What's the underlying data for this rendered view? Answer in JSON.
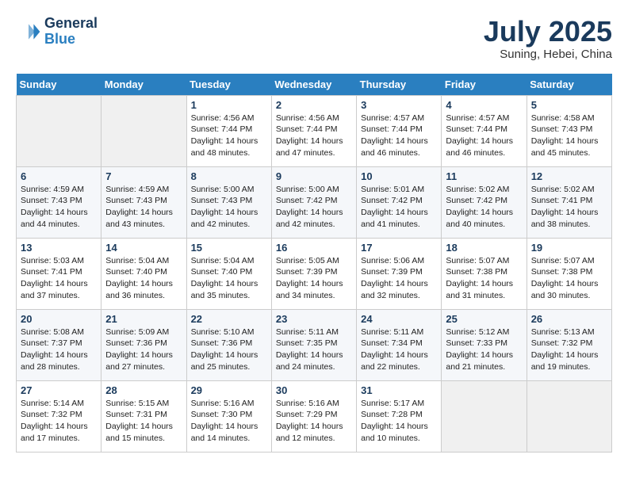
{
  "header": {
    "logo_line1": "General",
    "logo_line2": "Blue",
    "month": "July 2025",
    "location": "Suning, Hebei, China"
  },
  "days_of_week": [
    "Sunday",
    "Monday",
    "Tuesday",
    "Wednesday",
    "Thursday",
    "Friday",
    "Saturday"
  ],
  "weeks": [
    [
      {
        "day": "",
        "empty": true
      },
      {
        "day": "",
        "empty": true
      },
      {
        "day": "1",
        "sunrise": "Sunrise: 4:56 AM",
        "sunset": "Sunset: 7:44 PM",
        "daylight": "Daylight: 14 hours and 48 minutes."
      },
      {
        "day": "2",
        "sunrise": "Sunrise: 4:56 AM",
        "sunset": "Sunset: 7:44 PM",
        "daylight": "Daylight: 14 hours and 47 minutes."
      },
      {
        "day": "3",
        "sunrise": "Sunrise: 4:57 AM",
        "sunset": "Sunset: 7:44 PM",
        "daylight": "Daylight: 14 hours and 46 minutes."
      },
      {
        "day": "4",
        "sunrise": "Sunrise: 4:57 AM",
        "sunset": "Sunset: 7:44 PM",
        "daylight": "Daylight: 14 hours and 46 minutes."
      },
      {
        "day": "5",
        "sunrise": "Sunrise: 4:58 AM",
        "sunset": "Sunset: 7:43 PM",
        "daylight": "Daylight: 14 hours and 45 minutes."
      }
    ],
    [
      {
        "day": "6",
        "sunrise": "Sunrise: 4:59 AM",
        "sunset": "Sunset: 7:43 PM",
        "daylight": "Daylight: 14 hours and 44 minutes."
      },
      {
        "day": "7",
        "sunrise": "Sunrise: 4:59 AM",
        "sunset": "Sunset: 7:43 PM",
        "daylight": "Daylight: 14 hours and 43 minutes."
      },
      {
        "day": "8",
        "sunrise": "Sunrise: 5:00 AM",
        "sunset": "Sunset: 7:43 PM",
        "daylight": "Daylight: 14 hours and 42 minutes."
      },
      {
        "day": "9",
        "sunrise": "Sunrise: 5:00 AM",
        "sunset": "Sunset: 7:42 PM",
        "daylight": "Daylight: 14 hours and 42 minutes."
      },
      {
        "day": "10",
        "sunrise": "Sunrise: 5:01 AM",
        "sunset": "Sunset: 7:42 PM",
        "daylight": "Daylight: 14 hours and 41 minutes."
      },
      {
        "day": "11",
        "sunrise": "Sunrise: 5:02 AM",
        "sunset": "Sunset: 7:42 PM",
        "daylight": "Daylight: 14 hours and 40 minutes."
      },
      {
        "day": "12",
        "sunrise": "Sunrise: 5:02 AM",
        "sunset": "Sunset: 7:41 PM",
        "daylight": "Daylight: 14 hours and 38 minutes."
      }
    ],
    [
      {
        "day": "13",
        "sunrise": "Sunrise: 5:03 AM",
        "sunset": "Sunset: 7:41 PM",
        "daylight": "Daylight: 14 hours and 37 minutes."
      },
      {
        "day": "14",
        "sunrise": "Sunrise: 5:04 AM",
        "sunset": "Sunset: 7:40 PM",
        "daylight": "Daylight: 14 hours and 36 minutes."
      },
      {
        "day": "15",
        "sunrise": "Sunrise: 5:04 AM",
        "sunset": "Sunset: 7:40 PM",
        "daylight": "Daylight: 14 hours and 35 minutes."
      },
      {
        "day": "16",
        "sunrise": "Sunrise: 5:05 AM",
        "sunset": "Sunset: 7:39 PM",
        "daylight": "Daylight: 14 hours and 34 minutes."
      },
      {
        "day": "17",
        "sunrise": "Sunrise: 5:06 AM",
        "sunset": "Sunset: 7:39 PM",
        "daylight": "Daylight: 14 hours and 32 minutes."
      },
      {
        "day": "18",
        "sunrise": "Sunrise: 5:07 AM",
        "sunset": "Sunset: 7:38 PM",
        "daylight": "Daylight: 14 hours and 31 minutes."
      },
      {
        "day": "19",
        "sunrise": "Sunrise: 5:07 AM",
        "sunset": "Sunset: 7:38 PM",
        "daylight": "Daylight: 14 hours and 30 minutes."
      }
    ],
    [
      {
        "day": "20",
        "sunrise": "Sunrise: 5:08 AM",
        "sunset": "Sunset: 7:37 PM",
        "daylight": "Daylight: 14 hours and 28 minutes."
      },
      {
        "day": "21",
        "sunrise": "Sunrise: 5:09 AM",
        "sunset": "Sunset: 7:36 PM",
        "daylight": "Daylight: 14 hours and 27 minutes."
      },
      {
        "day": "22",
        "sunrise": "Sunrise: 5:10 AM",
        "sunset": "Sunset: 7:36 PM",
        "daylight": "Daylight: 14 hours and 25 minutes."
      },
      {
        "day": "23",
        "sunrise": "Sunrise: 5:11 AM",
        "sunset": "Sunset: 7:35 PM",
        "daylight": "Daylight: 14 hours and 24 minutes."
      },
      {
        "day": "24",
        "sunrise": "Sunrise: 5:11 AM",
        "sunset": "Sunset: 7:34 PM",
        "daylight": "Daylight: 14 hours and 22 minutes."
      },
      {
        "day": "25",
        "sunrise": "Sunrise: 5:12 AM",
        "sunset": "Sunset: 7:33 PM",
        "daylight": "Daylight: 14 hours and 21 minutes."
      },
      {
        "day": "26",
        "sunrise": "Sunrise: 5:13 AM",
        "sunset": "Sunset: 7:32 PM",
        "daylight": "Daylight: 14 hours and 19 minutes."
      }
    ],
    [
      {
        "day": "27",
        "sunrise": "Sunrise: 5:14 AM",
        "sunset": "Sunset: 7:32 PM",
        "daylight": "Daylight: 14 hours and 17 minutes."
      },
      {
        "day": "28",
        "sunrise": "Sunrise: 5:15 AM",
        "sunset": "Sunset: 7:31 PM",
        "daylight": "Daylight: 14 hours and 15 minutes."
      },
      {
        "day": "29",
        "sunrise": "Sunrise: 5:16 AM",
        "sunset": "Sunset: 7:30 PM",
        "daylight": "Daylight: 14 hours and 14 minutes."
      },
      {
        "day": "30",
        "sunrise": "Sunrise: 5:16 AM",
        "sunset": "Sunset: 7:29 PM",
        "daylight": "Daylight: 14 hours and 12 minutes."
      },
      {
        "day": "31",
        "sunrise": "Sunrise: 5:17 AM",
        "sunset": "Sunset: 7:28 PM",
        "daylight": "Daylight: 14 hours and 10 minutes."
      },
      {
        "day": "",
        "empty": true
      },
      {
        "day": "",
        "empty": true
      }
    ]
  ]
}
